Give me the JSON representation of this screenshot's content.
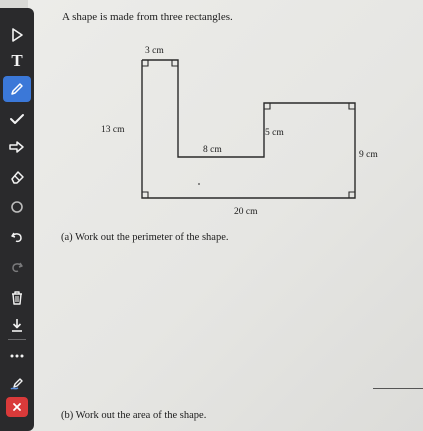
{
  "question": {
    "title": "A shape is made from three rectangles.",
    "part_a": "(a)  Work out the perimeter of the shape.",
    "part_b": "(b)  Work out the area of the shape."
  },
  "diagram": {
    "labels": {
      "top_width": "3 cm",
      "left_height": "13 cm",
      "inner_width": "8 cm",
      "step_height": "5 cm",
      "right_height": "9 cm",
      "bottom_width": "20 cm"
    }
  },
  "toolbar": {
    "tools": [
      {
        "name": "select-tool",
        "icon": "arrow-pointer-icon"
      },
      {
        "name": "text-tool",
        "icon": "text-icon",
        "glyph": "T"
      },
      {
        "name": "pen-tool",
        "icon": "pencil-icon",
        "selected": true
      },
      {
        "name": "check-tool",
        "icon": "check-icon"
      },
      {
        "name": "arrow-tool",
        "icon": "arrow-right-icon"
      },
      {
        "name": "eraser-tool",
        "icon": "eraser-icon"
      },
      {
        "name": "shape-tool",
        "icon": "circle-icon"
      },
      {
        "name": "undo-tool",
        "icon": "undo-icon"
      },
      {
        "name": "redo-tool",
        "icon": "redo-icon"
      },
      {
        "name": "delete-tool",
        "icon": "trash-icon"
      },
      {
        "name": "download-tool",
        "icon": "download-icon"
      },
      {
        "name": "more-tool",
        "icon": "more-dots-icon"
      },
      {
        "name": "color-tool",
        "icon": "pen-color-icon"
      },
      {
        "name": "close-tool",
        "icon": "close-icon"
      }
    ],
    "colors": {
      "background": "#2a2a2c",
      "selected": "#3b78d8",
      "close": "#d93a3a"
    }
  }
}
